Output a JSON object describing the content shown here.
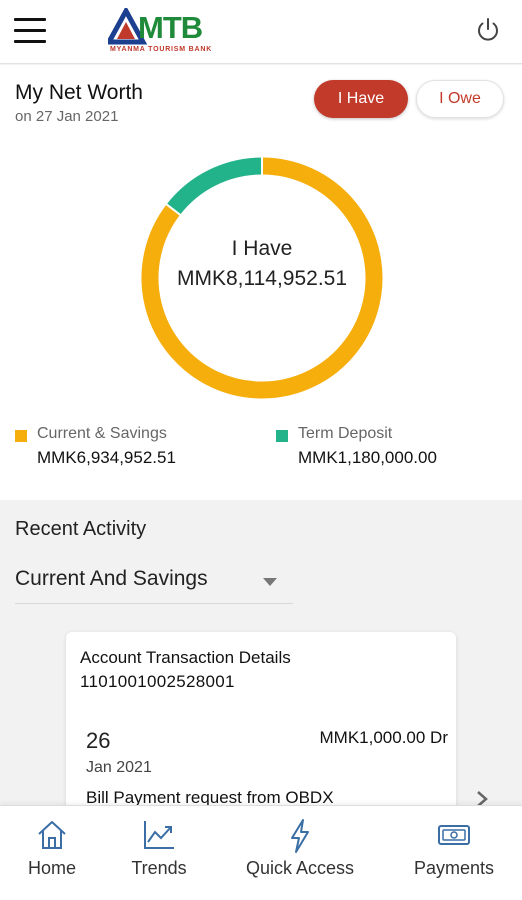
{
  "header": {
    "logo_text": "MTB",
    "logo_subtitle": "MYANMA TOURISM BANK",
    "menu_icon": "hamburger-menu-icon",
    "power_icon": "power-icon"
  },
  "net_worth": {
    "title": "My Net Worth",
    "date": "on 27 Jan 2021",
    "toggle": {
      "have_label": "I Have",
      "owe_label": "I Owe",
      "selected": "I Have"
    },
    "center_label": "I Have",
    "center_value": "MMK8,114,952.51",
    "colors": {
      "current_savings": "#F5AE0C",
      "term_deposit": "#22B38A",
      "accent": "#C23A2A"
    },
    "legend": [
      {
        "name": "Current & Savings",
        "value": "MMK6,934,952.51"
      },
      {
        "name": "Term Deposit",
        "value": "MMK1,180,000.00"
      }
    ]
  },
  "chart_data": {
    "type": "pie",
    "categories": [
      "Current & Savings",
      "Term Deposit"
    ],
    "values": [
      6934952.51,
      1180000.0
    ]
  },
  "recent_activity": {
    "title": "Recent Activity",
    "account_type": "Current And Savings",
    "card": {
      "heading": "Account Transaction Details",
      "account_number": "1101001002528001",
      "transaction": {
        "day": "26",
        "month_year": "Jan 2021",
        "amount": "MMK1,000.00 Dr",
        "description": "Bill Payment request from OBDX"
      }
    }
  },
  "bottom_nav": {
    "items": [
      {
        "label": "Home",
        "icon": "home-icon"
      },
      {
        "label": "Trends",
        "icon": "trends-icon"
      },
      {
        "label": "Quick Access",
        "icon": "lightning-icon"
      },
      {
        "label": "Payments",
        "icon": "payments-icon"
      }
    ]
  }
}
